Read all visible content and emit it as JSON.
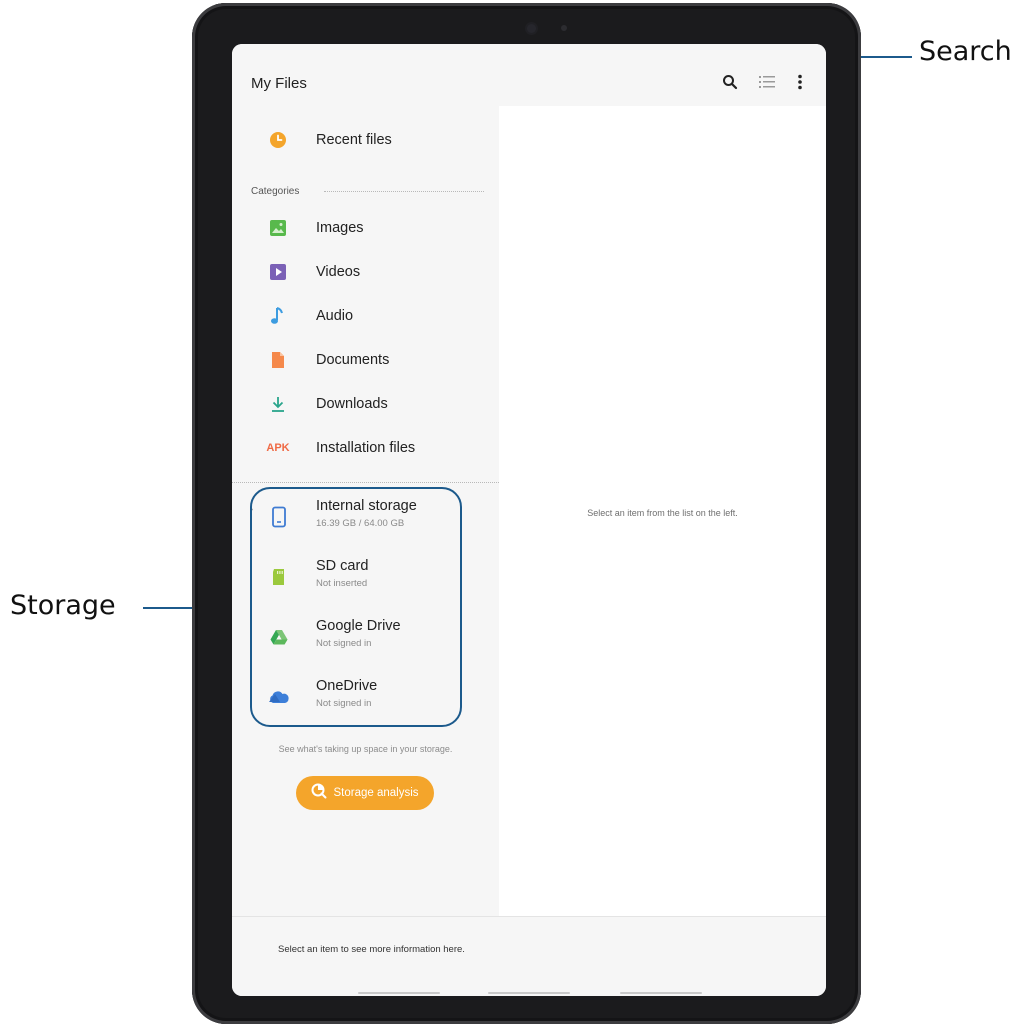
{
  "app": {
    "title": "My Files"
  },
  "toolbar": {
    "search_icon": "search-icon",
    "list_icon": "list-view-icon",
    "more_icon": "more-options-icon"
  },
  "recent": {
    "label": "Recent files",
    "icon": "clock-icon",
    "color": "#f4a52b"
  },
  "categories": {
    "heading": "Categories",
    "items": [
      {
        "label": "Images",
        "icon": "image-icon",
        "color": "#58b94c"
      },
      {
        "label": "Videos",
        "icon": "video-icon",
        "color": "#7b61b6"
      },
      {
        "label": "Audio",
        "icon": "music-note-icon",
        "color": "#3d9ce0"
      },
      {
        "label": "Documents",
        "icon": "document-icon",
        "color": "#f5894b"
      },
      {
        "label": "Downloads",
        "icon": "download-icon",
        "color": "#2aa58c"
      },
      {
        "label": "Installation files",
        "icon": "apk-icon",
        "badge": "APK",
        "color": "#ef6a45"
      }
    ]
  },
  "storage": {
    "items": [
      {
        "label": "Internal storage",
        "sub": "16.39 GB / 64.00 GB",
        "icon": "phone-icon",
        "color": "#3f7bd2"
      },
      {
        "label": "SD card",
        "sub": "Not inserted",
        "icon": "sd-card-icon",
        "color": "#9bc93d"
      },
      {
        "label": "Google Drive",
        "sub": "Not signed in",
        "icon": "google-drive-icon",
        "color": "#35a853"
      },
      {
        "label": "OneDrive",
        "sub": "Not signed in",
        "icon": "onedrive-icon",
        "color": "#3d7fd9"
      }
    ],
    "hint": "See what's taking up space in your storage.",
    "analysis_button": "Storage analysis"
  },
  "detail": {
    "placeholder": "Select an item from the list on the left."
  },
  "info": {
    "placeholder": "Select an item to see more information here."
  },
  "callouts": {
    "search": "Search",
    "storage": "Storage"
  },
  "colors": {
    "accent": "#f4a52b",
    "callout_line": "#1c5a8c"
  }
}
